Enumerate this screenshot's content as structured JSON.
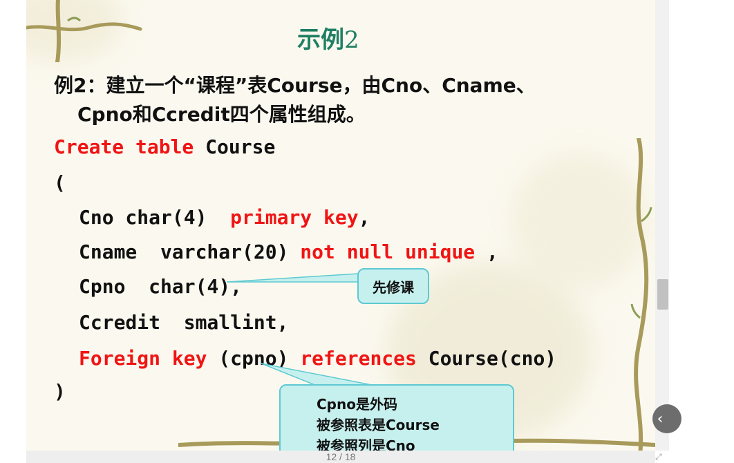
{
  "slide": {
    "title_text": "示例",
    "title_num": "2",
    "intro_line1": "例2：建立一个“课程”表Course，由Cno、Cname、",
    "intro_line2": "Cpno和Ccredit四个属性组成。",
    "code": {
      "l1_kw": "Create table",
      "l1_rest": " Course",
      "l2": "(",
      "l3_a": "Cno char(4)  ",
      "l3_kw": "primary key",
      "l3_b": ",",
      "l4_a": "Cname  varchar(20) ",
      "l4_kw": "not null unique",
      "l4_b": " ,",
      "l5": "Cpno  char(4),",
      "l6": "Ccredit  smallint,",
      "l7_kw1": "Foreign key",
      "l7_a": " (cpno) ",
      "l7_kw2": "references",
      "l7_b": " Course(cno)",
      "l8": ")"
    },
    "callout1": "先修课",
    "callout2": {
      "line1": "Cpno是外码",
      "line2": "被参照表是Course",
      "line3": "被参照列是Cno"
    },
    "colors": {
      "keyword": "#f01414",
      "title": "#1f7f63",
      "callout_fill": "#c6f0ee",
      "callout_border": "#5ec9d2"
    }
  },
  "viewer": {
    "page_indicator": "12 / 18",
    "prev_icon": "chevron-left-icon",
    "fullscreen_icon": "fullscreen-icon"
  }
}
